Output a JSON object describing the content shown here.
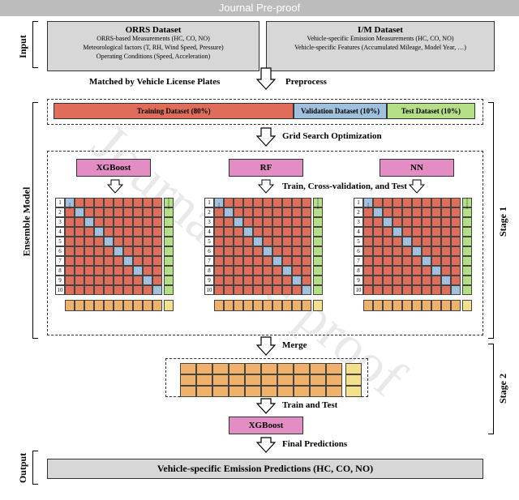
{
  "header": "Journal Pre-proof",
  "watermark": "Journal Pre-proof",
  "sections": {
    "input": "Input",
    "ensemble": "Ensemble Model",
    "output": "Output",
    "stage1": "Stage 1",
    "stage2": "Stage 2"
  },
  "cards": {
    "orrs_title": "ORRS Dataset",
    "orrs_l1": "ORRS-based Measurements (HC, CO, NO)",
    "orrs_l2": "Meteorological factors (T, RH, Wind Speed, Pressure)",
    "orrs_l3": "Operating Conditions (Speed, Acceleration)",
    "im_title": "I/M Dataset",
    "im_l1": "Vehicle-specific Emission Measurements (HC, CO, NO)",
    "im_l2": "Vehicle-specific Features  (Accumulated Mileage, Model Year, …)"
  },
  "arrows": {
    "match": "Matched by Vehicle License Plates",
    "preprocess": "Preprocess",
    "gridsearch": "Grid Search  Optimization",
    "tct": "Train, Cross-validation, and Test",
    "merge": "Merge",
    "train_test": "Train and Test",
    "final": "Final Predictions"
  },
  "split": {
    "train": "Training Dataset (80%)",
    "val": "Validation Dataset (10%)",
    "test": "Test Dataset (10%)"
  },
  "algos": {
    "xgb": "XGBoost",
    "rf": "RF",
    "nn": "NN"
  },
  "output": "Vehicle-specific Emission Predictions (HC, CO, NO)"
}
